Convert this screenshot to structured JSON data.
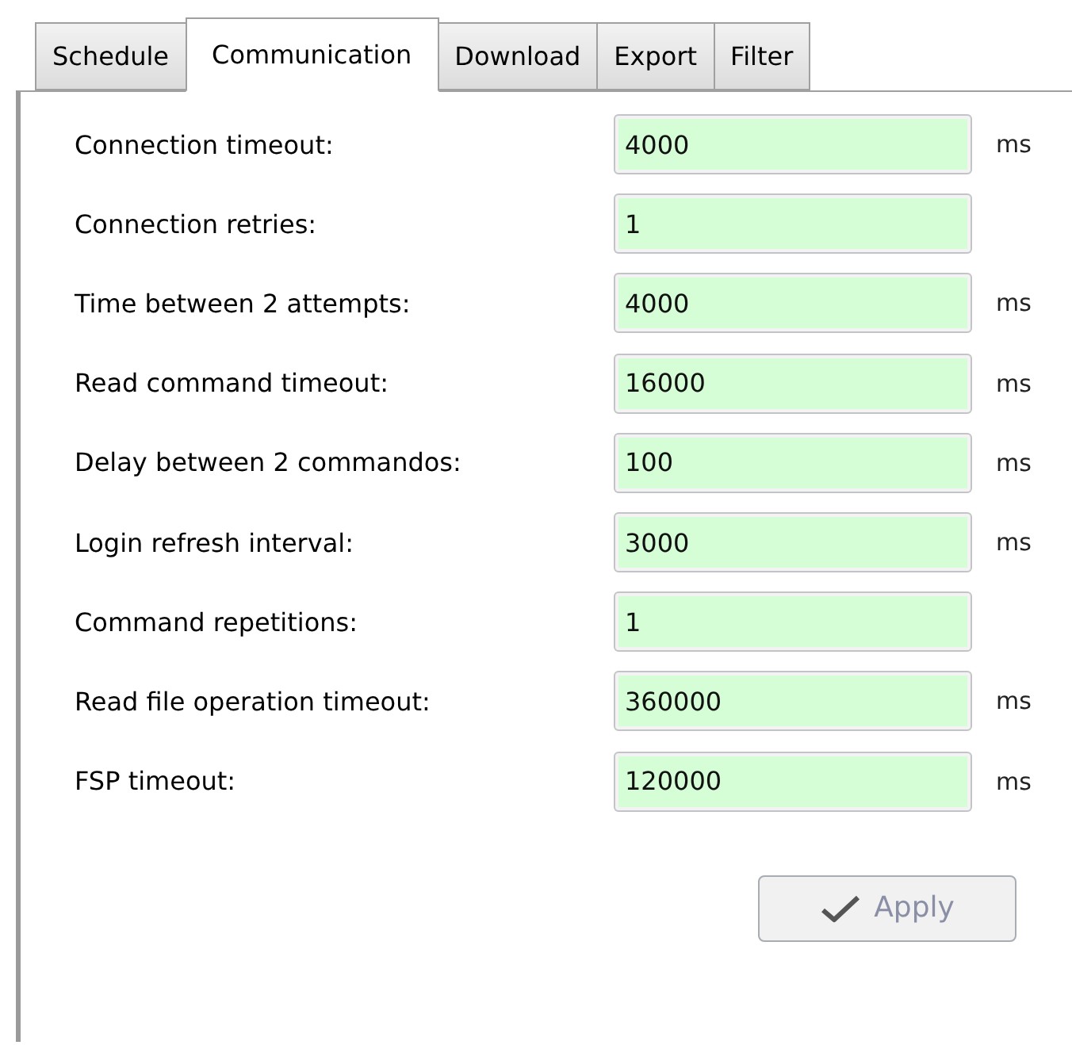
{
  "tabs": [
    {
      "label": "Schedule",
      "selected": false
    },
    {
      "label": "Communication",
      "selected": true
    },
    {
      "label": "Download",
      "selected": false
    },
    {
      "label": "Export",
      "selected": false
    },
    {
      "label": "Filter",
      "selected": false
    }
  ],
  "fields": [
    {
      "label": "Connection timeout:",
      "value": "4000",
      "unit": "ms"
    },
    {
      "label": "Connection retries:",
      "value": "1"
    },
    {
      "label": "Time between 2 attempts:",
      "value": "4000",
      "unit": "ms"
    },
    {
      "label": "Read command timeout:",
      "value": "16000",
      "unit": "ms"
    },
    {
      "label": "Delay between 2 commandos:",
      "value": "100",
      "unit": "ms"
    },
    {
      "label": "Login refresh interval:",
      "value": "3000",
      "unit": "ms"
    },
    {
      "label": "Command repetitions:",
      "value": "1"
    },
    {
      "label": "Read file operation timeout:",
      "value": "360000",
      "unit": "ms"
    },
    {
      "label": "FSP timeout:",
      "value": "120000",
      "unit": "ms"
    }
  ],
  "apply_button": {
    "label": "Apply",
    "disabled": true
  }
}
